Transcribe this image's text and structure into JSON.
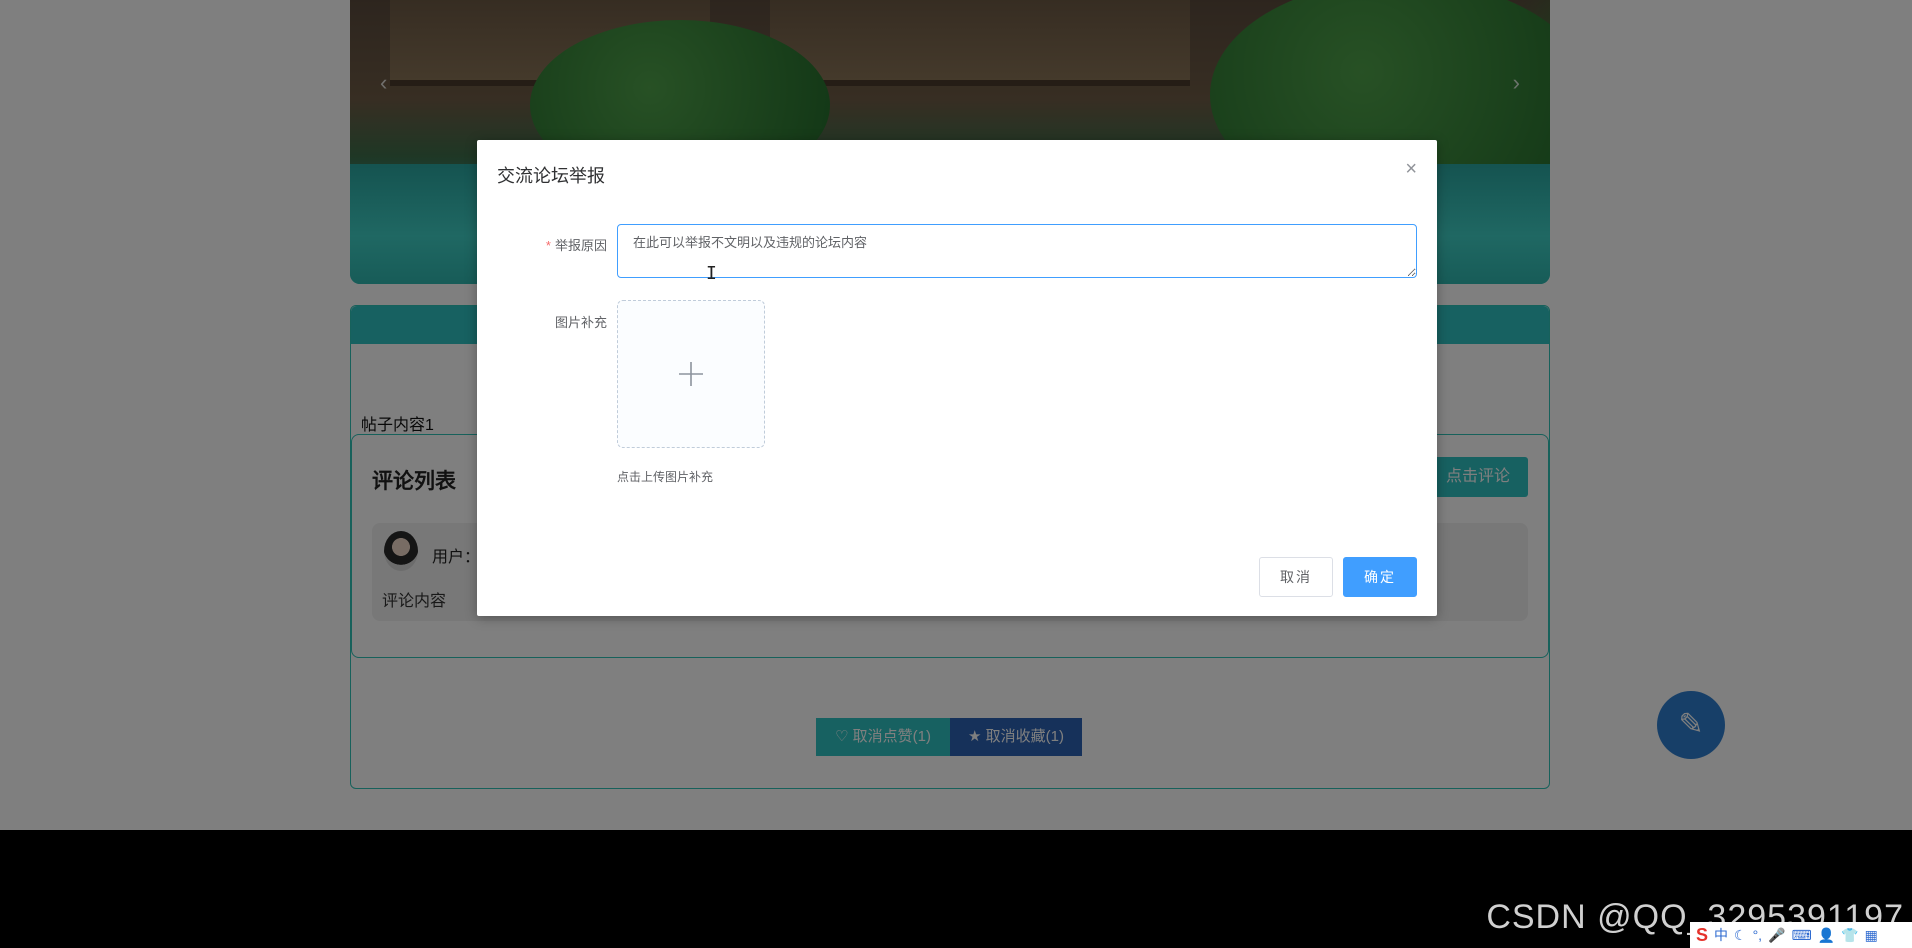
{
  "post": {
    "content": "帖子内容1"
  },
  "comments": {
    "title": "评论列表",
    "add_button": "点击评论",
    "items": [
      {
        "user_label": "用户：",
        "content": "评论内容"
      }
    ]
  },
  "actions": {
    "unlike_label": "♡ 取消点赞(1)",
    "unfavorite_label": "★ 取消收藏(1)"
  },
  "modal": {
    "title": "交流论坛举报",
    "close_icon": "close-icon",
    "reason_label": "举报原因",
    "reason_value": "在此可以举报不文明以及违规的论坛内容",
    "image_label": "图片补充",
    "upload_tip": "点击上传图片补充",
    "cancel_label": "取消",
    "confirm_label": "确定"
  },
  "watermark": "CSDN @QQ_3295391197",
  "tray": {
    "logo": "S",
    "ime": "中"
  },
  "colors": {
    "accent_teal": "#2fc3c3",
    "primary_blue": "#409eff",
    "favorite_blue": "#2d63b4"
  }
}
